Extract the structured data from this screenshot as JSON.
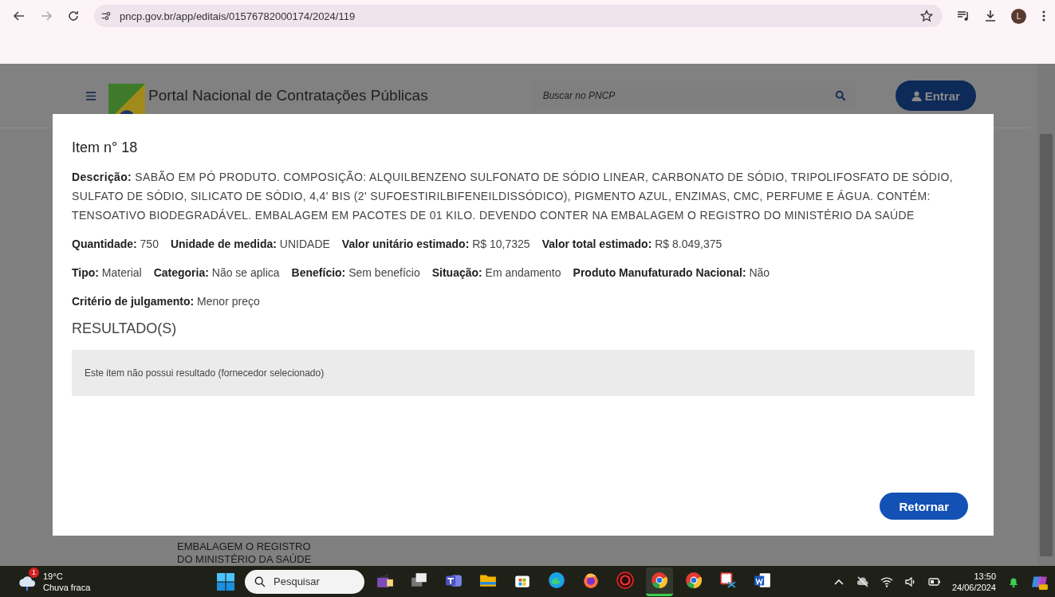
{
  "browser": {
    "url": "pncp.gov.br/app/editais/01576782000174/2024/119",
    "profile_initial": "L"
  },
  "page_header": {
    "title": "Portal Nacional de Contratações Públicas",
    "search_placeholder": "Buscar no PNCP",
    "login_button": "Entrar"
  },
  "background_text": [
    "EMBALAGEM O REGISTRO",
    "DO MINISTÉRIO DA SAÚDE"
  ],
  "modal": {
    "title": "Item n° 18",
    "description": {
      "label": "Descrição:",
      "text": "SABÃO EM PÓ PRODUTO. COMPOSIÇÃO: ALQUILBENZENO SULFONATO DE SÓDIO LINEAR, CARBONATO DE SÓDIO, TRIPOLIFOSFATO DE SÓDIO, SULFATO DE SÓDIO, SILICATO DE SÓDIO, 4,4' BIS (2' SUFOESTIRILBIFENEILDISSÓDICO), PIGMENTO AZUL, ENZIMAS, CMC, PERFUME E ÁGUA. CONTÉM: TENSOATIVO BIODEGRADÁVEL. EMBALAGEM EM PACOTES DE 01 KILO. DEVENDO CONTER NA EMBALAGEM O REGISTRO DO MINISTÉRIO DA SAÚDE"
    },
    "field_rows": [
      [
        {
          "label": "Quantidade:",
          "value": "750"
        },
        {
          "label": "Unidade de medida:",
          "value": "UNIDADE"
        },
        {
          "label": "Valor unitário estimado:",
          "value": "R$ 10,7325"
        },
        {
          "label": "Valor total estimado:",
          "value": "R$ 8.049,375"
        }
      ],
      [
        {
          "label": "Tipo:",
          "value": "Material"
        },
        {
          "label": "Categoria:",
          "value": "Não se aplica"
        },
        {
          "label": "Benefício:",
          "value": "Sem benefício"
        },
        {
          "label": "Situação:",
          "value": "Em andamento"
        },
        {
          "label": "Produto Manufaturado Nacional:",
          "value": "Não"
        }
      ],
      [
        {
          "label": "Critério de julgamento:",
          "value": "Menor preço"
        }
      ]
    ],
    "results_title": "RESULTADO(S)",
    "results_message": "Este item não possui resultado (fornecedor selecionado)",
    "return_button": "Retornar"
  },
  "taskbar": {
    "weather": {
      "badge": "1",
      "temperature": "19°C",
      "condition": "Chuva fraca"
    },
    "search_placeholder": "Pesquisar",
    "apps": [
      {
        "kind": "widgets",
        "selected": false
      },
      {
        "kind": "taskview",
        "selected": false
      },
      {
        "kind": "teams",
        "selected": false
      },
      {
        "kind": "folder",
        "selected": false
      },
      {
        "kind": "store",
        "selected": false
      },
      {
        "kind": "edge",
        "selected": false
      },
      {
        "kind": "firefox",
        "selected": false
      },
      {
        "kind": "shield",
        "selected": false
      },
      {
        "kind": "chrome",
        "selected": true
      },
      {
        "kind": "chrome",
        "selected": false
      },
      {
        "kind": "snip",
        "selected": false
      },
      {
        "kind": "word",
        "selected": false
      }
    ],
    "time": "13:50",
    "date": "24/06/2024"
  }
}
